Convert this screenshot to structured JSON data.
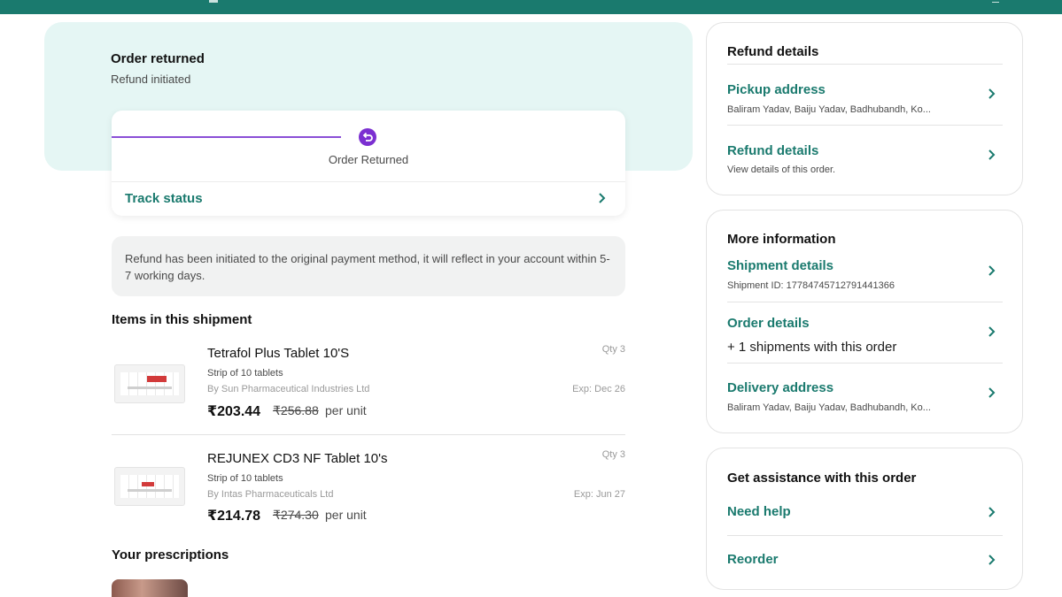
{
  "colors": {
    "brand": "#1a7a6e",
    "hero_bg": "#e5f6f4",
    "return_accent": "#7b2fd1"
  },
  "status": {
    "title": "Order returned",
    "subtitle": "Refund initiated",
    "step_label": "Order Returned",
    "step_icon": "return-icon",
    "track_link": "Track status"
  },
  "notice": "Refund has been initiated to the original payment method, it will reflect in your account within 5-7 working days.",
  "items_section_title": "Items in this shipment",
  "items": [
    {
      "name": "Tetrafol Plus Tablet 10'S",
      "pack": "Strip of 10 tablets",
      "manufacturer": "By Sun Pharmaceutical Industries Ltd",
      "qty": "Qty 3",
      "expiry": "Exp: Dec 26",
      "price": "₹203.44",
      "mrp": "₹256.88",
      "unit": "per unit"
    },
    {
      "name": "REJUNEX CD3 NF Tablet 10's",
      "pack": "Strip of 10 tablets",
      "manufacturer": "By Intas Pharmaceuticals Ltd",
      "qty": "Qty 3",
      "expiry": "Exp: Jun 27",
      "price": "₹214.78",
      "mrp": "₹274.30",
      "unit": "per unit"
    }
  ],
  "prescriptions_title": "Your prescriptions",
  "refund_card": {
    "title": "Refund details",
    "rows": [
      {
        "label": "Pickup address",
        "sub": "Baliram Yadav, Baiju Yadav, Badhubandh, Ko..."
      },
      {
        "label": "Refund details",
        "sub": "View details of this order."
      }
    ]
  },
  "info_card": {
    "title": "More information",
    "rows": [
      {
        "label": "Shipment details",
        "sub": "Shipment ID: 17784745712791441366"
      },
      {
        "label": "Order details",
        "sub": "+ 1 shipments with this order"
      },
      {
        "label": "Delivery address",
        "sub": "Baliram Yadav, Baiju Yadav, Badhubandh, Ko..."
      }
    ]
  },
  "assist_card": {
    "title": "Get assistance with this order",
    "rows": [
      {
        "label": "Need help"
      },
      {
        "label": "Reorder"
      }
    ]
  }
}
